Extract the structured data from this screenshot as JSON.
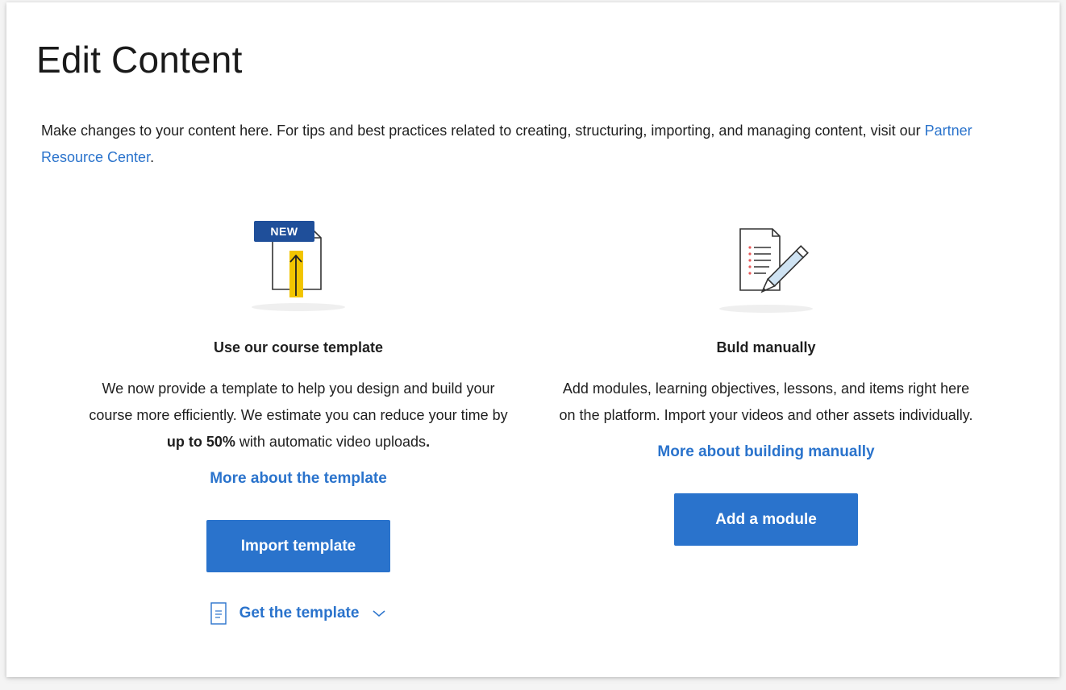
{
  "page": {
    "title": "Edit Content",
    "intro_text": "Make changes to your content here. For tips and best practices related to creating, structuring, importing, and managing content, visit our ",
    "intro_link": "Partner Resource Center",
    "intro_end": "."
  },
  "template_option": {
    "badge": "NEW",
    "heading": "Use our course template",
    "desc_pre": "We now provide a template to help you design and build your course more efficiently. We estimate you can reduce your time by ",
    "desc_bold": "up to 50%",
    "desc_post": " with automatic video uploads",
    "desc_end": ".",
    "more_link": "More about the template",
    "button_label": "Import template",
    "get_template_label": "Get the template",
    "doc_icon": "document-icon",
    "chevron_icon": "chevron-down-icon"
  },
  "manual_option": {
    "heading": "Buld manually",
    "desc": "Add modules, learning objectives, lessons, and items right here on the platform. Import your videos and other assets individually.",
    "more_link": "More about building manually",
    "button_label": "Add a module"
  },
  "colors": {
    "accent": "#2a73cc",
    "badge_bg": "#1f4f9a",
    "highlight_yellow": "#f2c500"
  }
}
